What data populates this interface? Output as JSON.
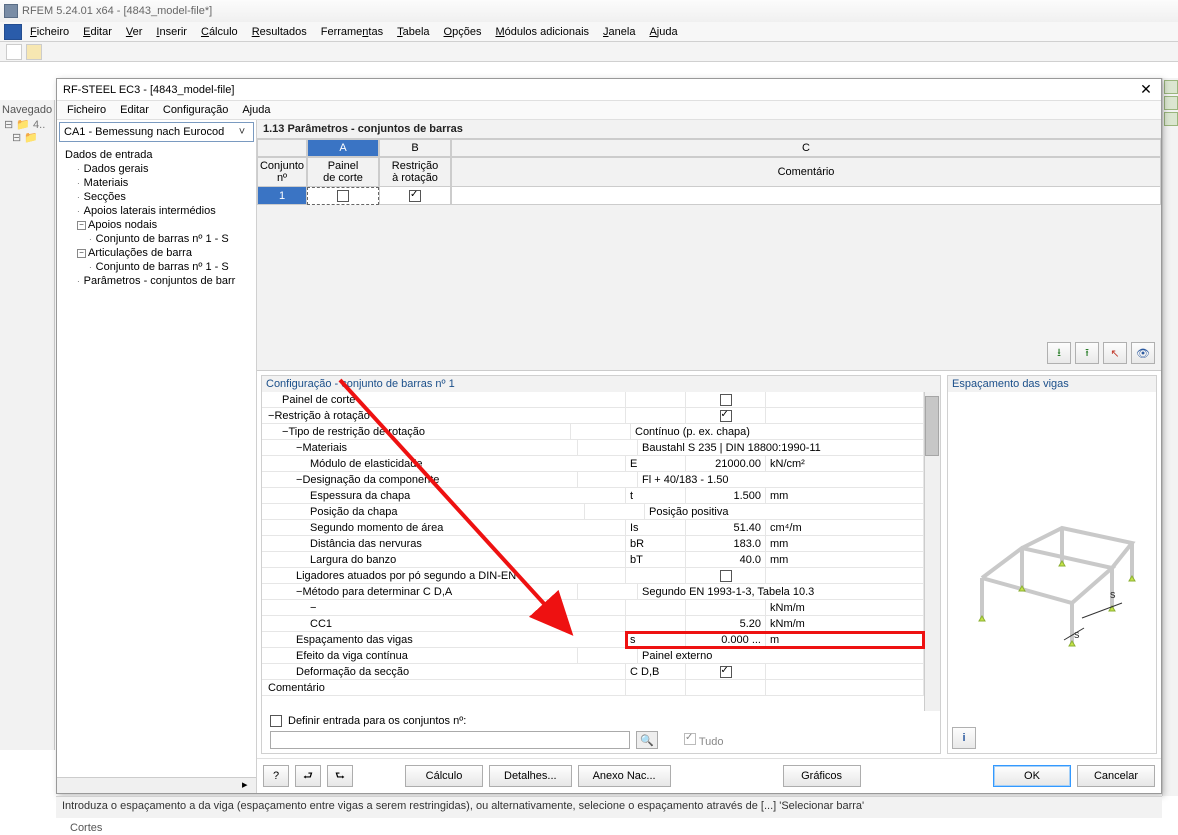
{
  "app": {
    "title": "RFEM 5.24.01 x64 - [4843_model-file*]"
  },
  "main_menu": [
    "Ficheiro",
    "Editar",
    "Ver",
    "Inserir",
    "Cálculo",
    "Resultados",
    "Ferramentas",
    "Tabela",
    "Opções",
    "Módulos adicionais",
    "Janela",
    "Ajuda"
  ],
  "nav_label": "Navegado",
  "sub": {
    "title": "RF-STEEL EC3 - [4843_model-file]",
    "menu": [
      "Ficheiro",
      "Editar",
      "Configuração",
      "Ajuda"
    ]
  },
  "combo_value": "CA1 - Bemessung nach Eurocod",
  "tree": {
    "root": "Dados de entrada",
    "items": [
      "Dados gerais",
      "Materiais",
      "Secções",
      "Apoios laterais intermédios",
      "Apoios nodais",
      "Conjunto de barras nº 1 - S",
      "Articulações de barra",
      "Conjunto de barras nº 1 - S",
      "Parâmetros - conjuntos de barr"
    ]
  },
  "panel_title": "1.13 Parâmetros - conjuntos de barras",
  "grid": {
    "col_letters": [
      "A",
      "B",
      "C"
    ],
    "head_row0": "Conjunto\nnº",
    "head_a": "Painel\nde corte",
    "head_b": "Restrição\nà rotação",
    "head_c": "Comentário",
    "row1_id": "1",
    "row1_a_checked": false,
    "row1_b_checked": true
  },
  "config_title": "Configuração - conjunto de barras nº 1",
  "detail": [
    {
      "label": "Painel de corte",
      "sym": "",
      "val": "",
      "unit": "",
      "cb": "unchecked",
      "ind": 1
    },
    {
      "label": "Restrição à rotação",
      "sym": "",
      "val": "",
      "unit": "",
      "cb": "checked",
      "ind": 0,
      "pm": "-"
    },
    {
      "label": "Tipo de restrição de rotação",
      "sym": "",
      "val": "Contínuo (p. ex. chapa)",
      "unit": "",
      "ind": 1,
      "pm": "-"
    },
    {
      "label": "Materiais",
      "sym": "",
      "val": "Baustahl S 235 | DIN 18800:1990-11",
      "unit": "",
      "ind": 2,
      "pm": "-"
    },
    {
      "label": "Módulo de elasticidade",
      "sym": "E",
      "val": "21000.00",
      "unit": "kN/cm²",
      "ind": 3
    },
    {
      "label": "Designação da componente",
      "sym": "",
      "val": "Fl + 40/183 - 1.50",
      "unit": "",
      "ind": 2,
      "pm": "-"
    },
    {
      "label": "Espessura da chapa",
      "sym": "t",
      "val": "1.500",
      "unit": "mm",
      "ind": 3
    },
    {
      "label": "Posição da chapa",
      "sym": "",
      "val": "Posição positiva",
      "unit": "",
      "ind": 3
    },
    {
      "label": "Segundo momento de área",
      "sym": "Is",
      "val": "51.40",
      "unit": "cm⁴/m",
      "ind": 3
    },
    {
      "label": "Distância das nervuras",
      "sym": "bR",
      "val": "183.0",
      "unit": "mm",
      "ind": 3
    },
    {
      "label": "Largura do banzo",
      "sym": "bT",
      "val": "40.0",
      "unit": "mm",
      "ind": 3
    },
    {
      "label": "Ligadores atuados por pó segundo a DIN-EN",
      "sym": "",
      "val": "",
      "unit": "",
      "cb": "unchecked",
      "ind": 2
    },
    {
      "label": "Método para determinar C D,A",
      "sym": "",
      "val": "Segundo EN 1993-1-3, Tabela 10.3",
      "unit": "",
      "ind": 2,
      "pm": "-"
    },
    {
      "label": "",
      "sym": "",
      "val": "",
      "unit": "kNm/m",
      "ind": 3,
      "pm": "-"
    },
    {
      "label": "CC1",
      "sym": "",
      "val": "5.20",
      "unit": "kNm/m",
      "ind": 3
    },
    {
      "label": "Espaçamento das vigas",
      "sym": "s",
      "val": "0.000 ...",
      "unit": "m",
      "ind": 2,
      "hl": true
    },
    {
      "label": "Efeito da viga contínua",
      "sym": "",
      "val": "Painel externo",
      "unit": "",
      "ind": 2
    },
    {
      "label": "Deformação da secção",
      "sym": "C D,B",
      "val": "",
      "unit": "",
      "cb": "checked",
      "ind": 2
    },
    {
      "label": "Comentário",
      "sym": "",
      "val": "",
      "unit": "",
      "ind": 0
    }
  ],
  "bottom": {
    "define_label": "Definir entrada para os conjuntos nº:",
    "tudo": "Tudo"
  },
  "info_panel_title": "Espaçamento das vigas",
  "buttons": {
    "calc": "Cálculo",
    "details": "Detalhes...",
    "anexo": "Anexo Nac...",
    "graficos": "Gráficos",
    "ok": "OK",
    "cancel": "Cancelar"
  },
  "status": "Introduza o espaçamento a da viga (espaçamento entre vigas a serem restringidas), ou alternativamente, selecione o espaçamento através de [...] 'Selecionar barra'",
  "bg_bottom": "Cortes"
}
